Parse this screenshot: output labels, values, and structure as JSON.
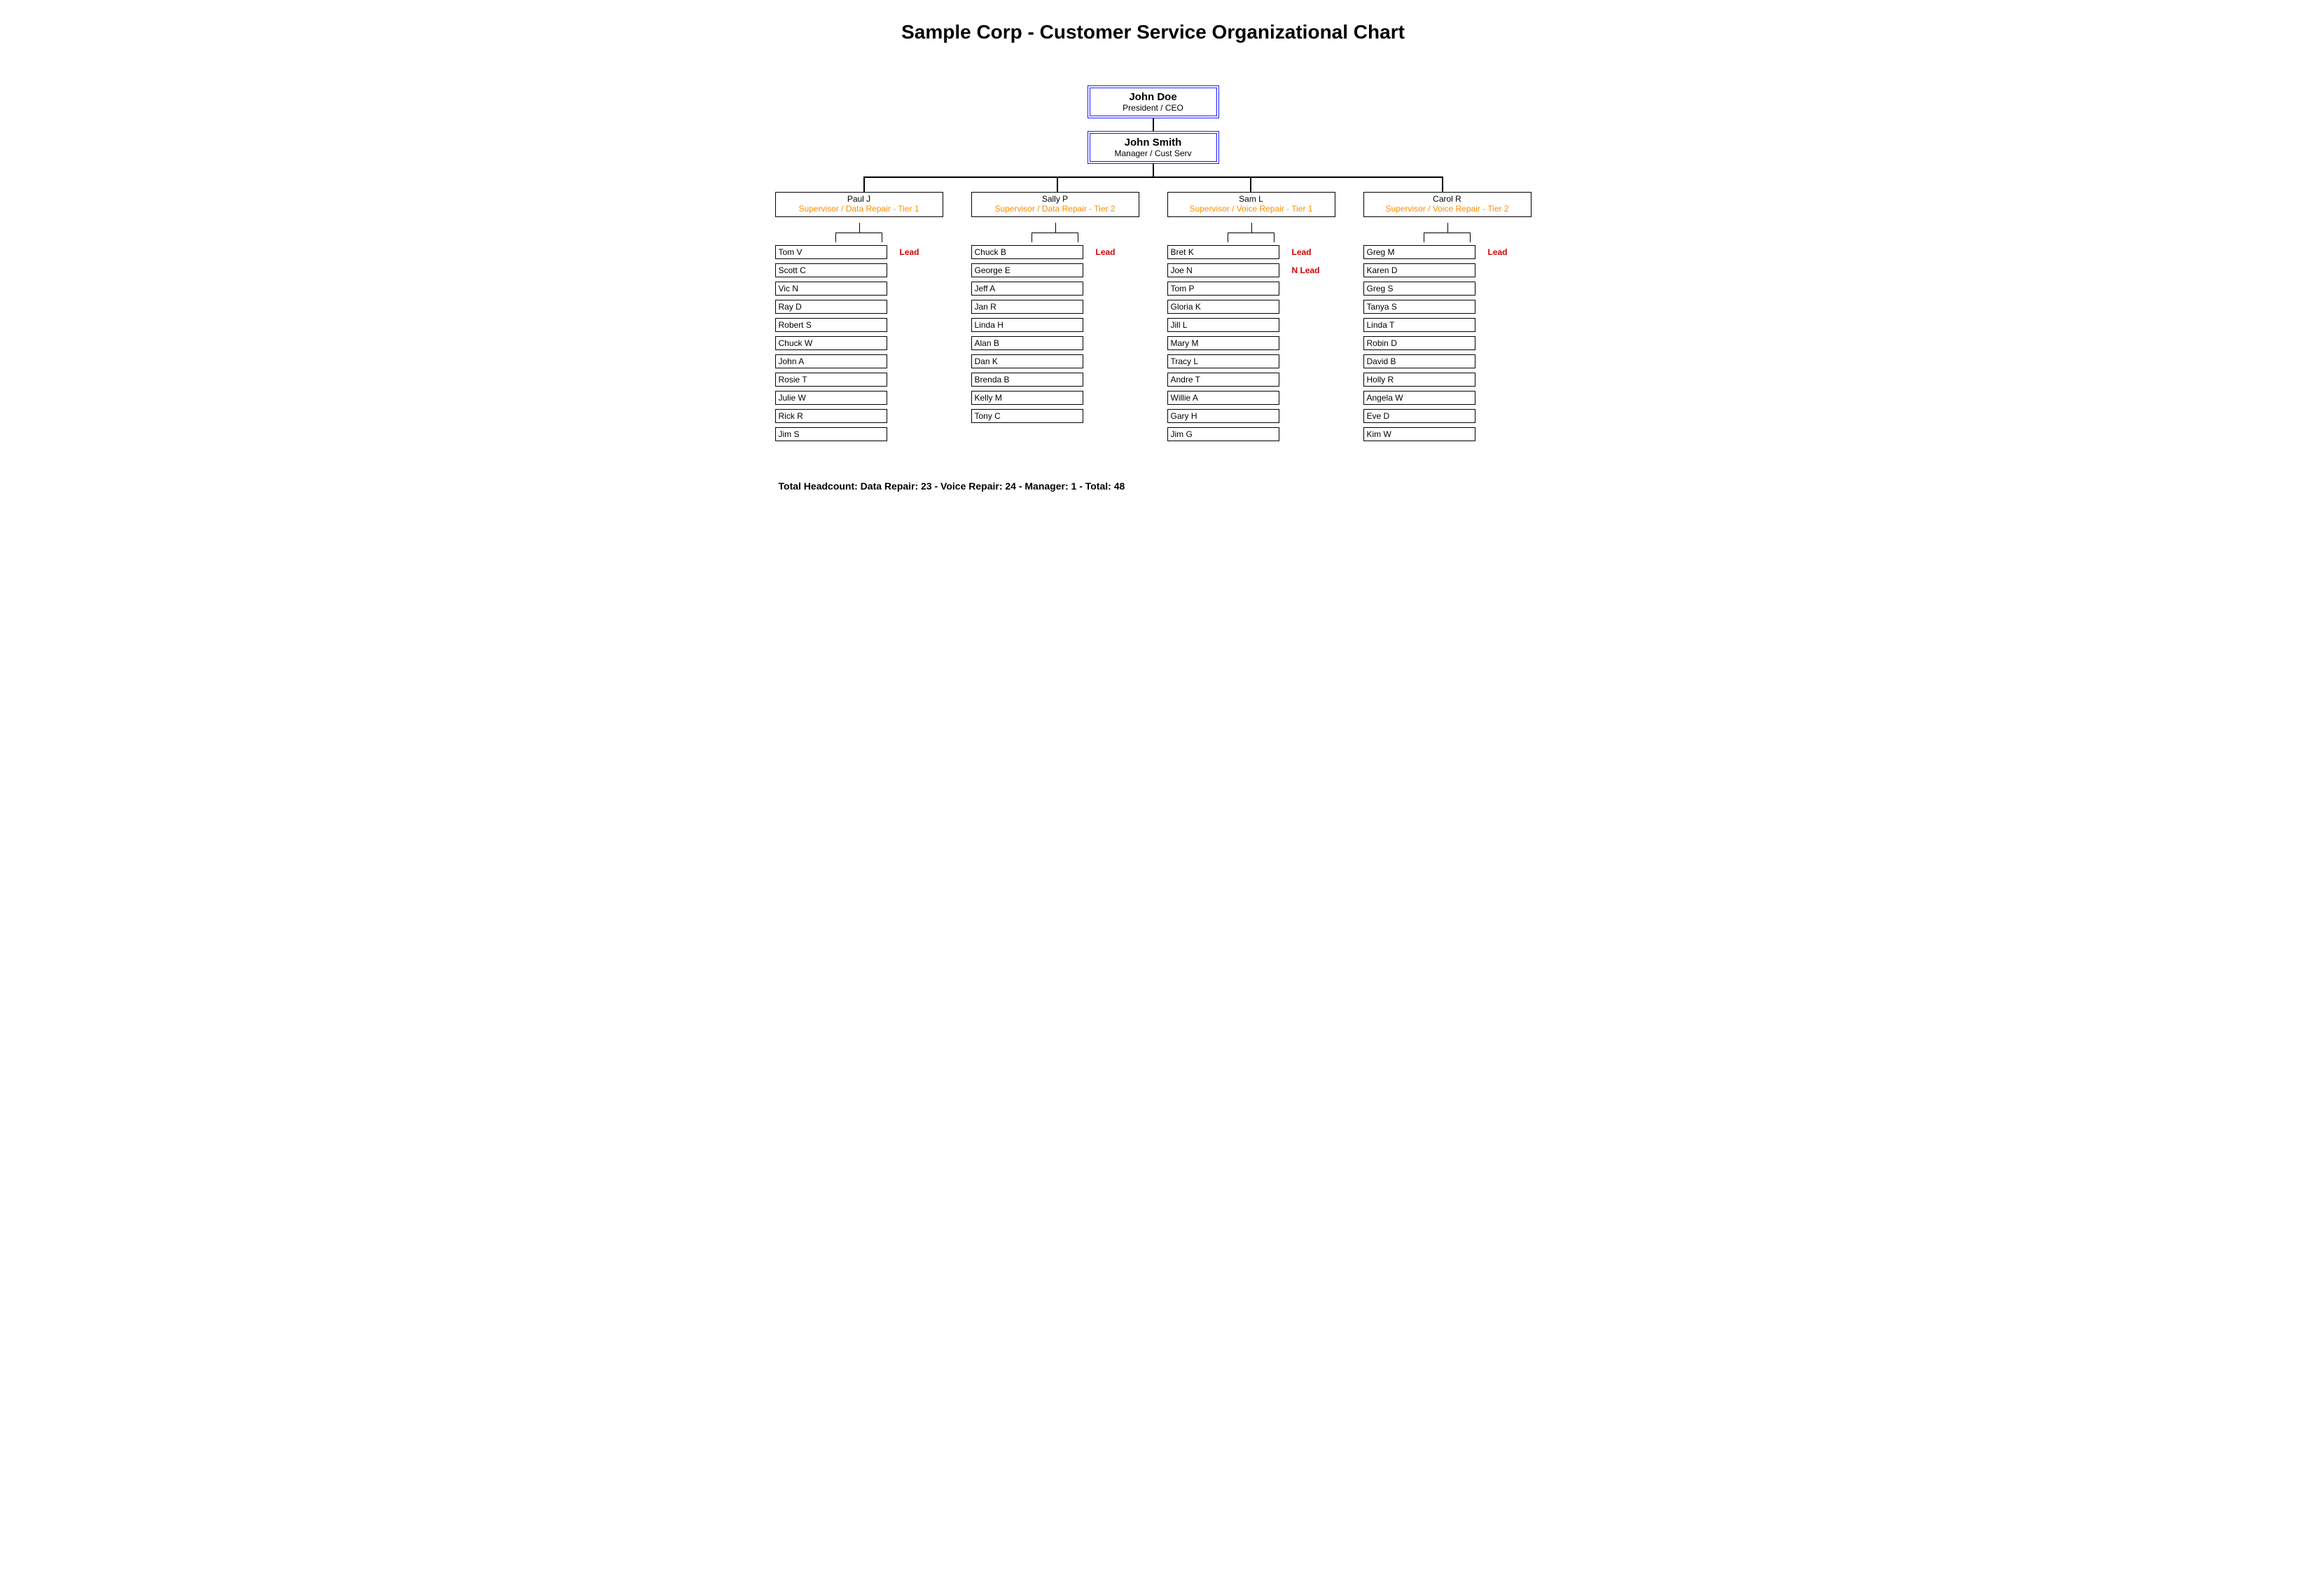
{
  "title": "Sample Corp - Customer Service Organizational Chart",
  "top": [
    {
      "name": "John Doe",
      "role": "President / CEO"
    },
    {
      "name": "John Smith",
      "role": "Manager / Cust Serv"
    }
  ],
  "teams": [
    {
      "supervisor": {
        "name": "Paul J",
        "role": "Supervisor / Data Repair - Tier 1"
      },
      "members": [
        {
          "name": "Tom V",
          "tag": "Lead"
        },
        {
          "name": "Scott C"
        },
        {
          "name": "Vic N"
        },
        {
          "name": "Ray D"
        },
        {
          "name": "Robert S"
        },
        {
          "name": "Chuck W"
        },
        {
          "name": "John A"
        },
        {
          "name": "Rosie T"
        },
        {
          "name": "Julie W"
        },
        {
          "name": "Rick R"
        },
        {
          "name": "Jim S"
        }
      ]
    },
    {
      "supervisor": {
        "name": "Sally P",
        "role": "Supervisor / Data Repair - Tier 2"
      },
      "members": [
        {
          "name": "Chuck B",
          "tag": "Lead"
        },
        {
          "name": "George E"
        },
        {
          "name": "Jeff A"
        },
        {
          "name": "Jan R"
        },
        {
          "name": "Linda H"
        },
        {
          "name": "Alan B"
        },
        {
          "name": "Dan K"
        },
        {
          "name": "Brenda B"
        },
        {
          "name": "Kelly M"
        },
        {
          "name": "Tony C"
        }
      ]
    },
    {
      "supervisor": {
        "name": "Sam L",
        "role": "Supervisor / Voice Repair - Tier 1"
      },
      "members": [
        {
          "name": "Bret K",
          "tag": "Lead"
        },
        {
          "name": "Joe N",
          "tag": "N Lead"
        },
        {
          "name": "Tom P"
        },
        {
          "name": "Gloria K"
        },
        {
          "name": "Jill L"
        },
        {
          "name": "Mary M"
        },
        {
          "name": "Tracy L"
        },
        {
          "name": "Andre T"
        },
        {
          "name": "Willie A"
        },
        {
          "name": "Gary H"
        },
        {
          "name": "Jim G"
        }
      ]
    },
    {
      "supervisor": {
        "name": "Carol R",
        "role": "Supervisor / Voice Repair - Tier 2"
      },
      "members": [
        {
          "name": "Greg M",
          "tag": "Lead"
        },
        {
          "name": "Karen D"
        },
        {
          "name": "Greg S"
        },
        {
          "name": "Tanya S"
        },
        {
          "name": "Linda T"
        },
        {
          "name": "Robin D"
        },
        {
          "name": "David B"
        },
        {
          "name": "Holly R"
        },
        {
          "name": "Angela W"
        },
        {
          "name": "Eve D"
        },
        {
          "name": "Kim W"
        }
      ]
    }
  ],
  "footer": "Total Headcount:  Data Repair: 23  -  Voice Repair: 24  -  Manager: 1  -   Total: 48",
  "chart_data": {
    "type": "table",
    "title": "Customer Service Org Chart Headcount",
    "categories": [
      "Data Repair",
      "Voice Repair",
      "Manager",
      "Total"
    ],
    "values": [
      23,
      24,
      1,
      48
    ]
  }
}
